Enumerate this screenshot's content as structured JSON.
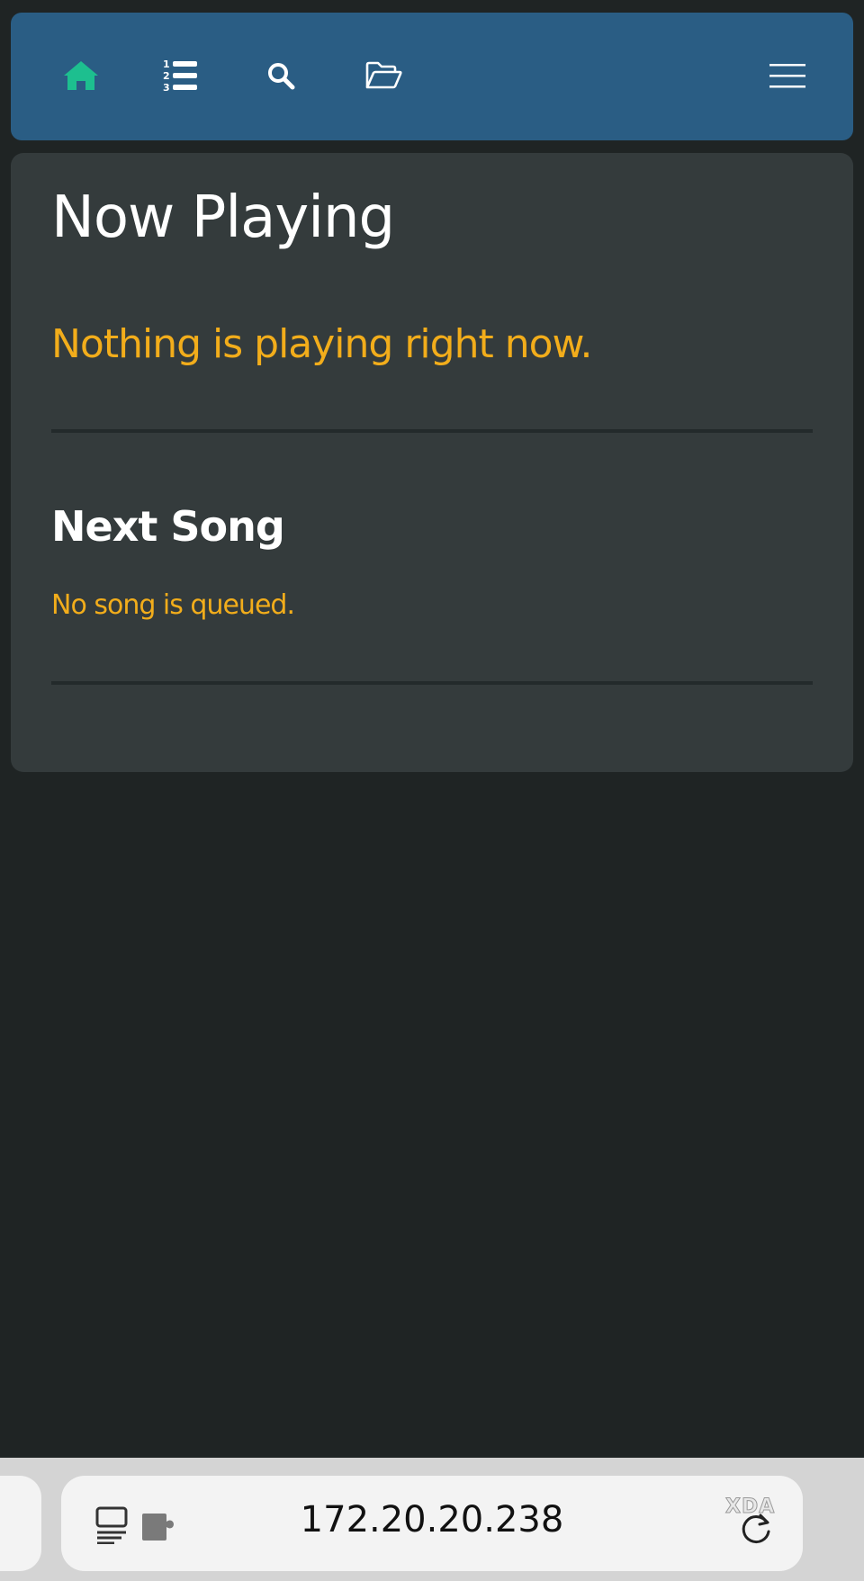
{
  "navbar": {
    "items": [
      {
        "name": "home",
        "icon": "home-icon",
        "active": true
      },
      {
        "name": "queue",
        "icon": "ordered-list-icon"
      },
      {
        "name": "search",
        "icon": "search-icon"
      },
      {
        "name": "browse",
        "icon": "folder-open-icon"
      }
    ],
    "menu_icon": "hamburger-menu-icon",
    "background_color": "#2a5d84",
    "active_color": "#1dbf8f"
  },
  "main": {
    "title": "Now Playing",
    "status": "Nothing is playing right now.",
    "next_song": {
      "heading": "Next Song",
      "status": "No song is queued."
    },
    "accent_color": "#f2ad1b"
  },
  "browser": {
    "url": "172.20.20.238",
    "reader_icon": "reader-mode-icon",
    "extension_icon": "extension-puzzle-icon",
    "reload_icon": "reload-icon",
    "watermark": "XDA"
  }
}
